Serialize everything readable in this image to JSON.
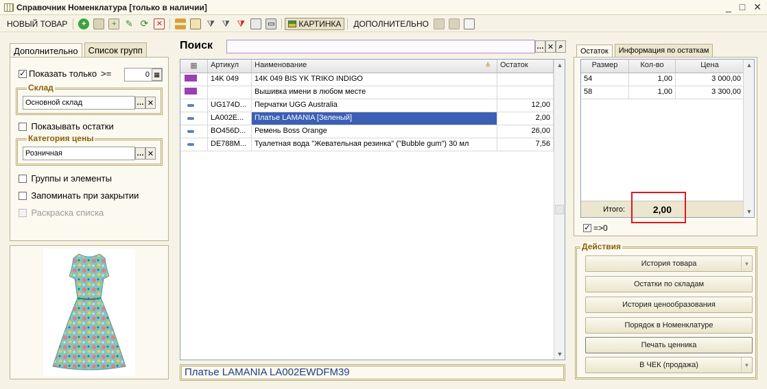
{
  "window": {
    "title": "Справочник Номенклатура [только в наличии]",
    "controls": [
      "_",
      "□",
      "✕"
    ]
  },
  "toolbar": {
    "new_item": "НОВЫЙ ТОВАР",
    "picture": "КАРТИНКА",
    "additional": "ДОПОЛНИТЕЛЬНО"
  },
  "left": {
    "tabs": [
      "Дополнительно",
      "Список групп"
    ],
    "show_only_label": "Показать только",
    "ge": ">=",
    "show_only_value": "0",
    "warehouse_title": "Склад",
    "warehouse_value": "Основной склад",
    "show_remains": "Показывать остатки",
    "price_category_title": "Категория цены",
    "price_category_value": "Розничная",
    "groups_and_elements": "Группы и элементы",
    "remember_on_close": "Запоминать при закрытии",
    "list_coloring": "Раскраска списка"
  },
  "search": {
    "label": "Поиск",
    "value": ""
  },
  "grid": {
    "columns": [
      "Артикул",
      "Наименование",
      "Остаток"
    ],
    "rows": [
      {
        "icon": "group",
        "article": "14K 049",
        "name": "14K 049 BIS YK TRIKO INDIGO",
        "stock": ""
      },
      {
        "icon": "group",
        "article": "",
        "name": "Вышивка имени в любом месте",
        "stock": ""
      },
      {
        "icon": "item",
        "article": "UG174D...",
        "name": "Перчатки UGG Australia",
        "stock": "12,00"
      },
      {
        "icon": "item",
        "article": "LA002E...",
        "name": "Платье LAMANIA [Зеленый]",
        "stock": "2,00"
      },
      {
        "icon": "item",
        "article": "BO456D...",
        "name": "Ремень Boss Orange",
        "stock": "26,00"
      },
      {
        "icon": "item",
        "article": "DE788M...",
        "name": "Туалетная вода \"Жевательная резинка\" (\"Bubble gum\") 30 мл",
        "stock": "7,56"
      }
    ],
    "selected_index": 3
  },
  "status": {
    "text": "Платье LAMANIA LA002EWDFM39"
  },
  "right": {
    "tabs": [
      "Остаток",
      "Информация по остаткам"
    ],
    "columns": [
      "Размер",
      "Кол-во",
      "Цена"
    ],
    "rows": [
      {
        "size": "54",
        "qty": "1,00",
        "price": "3 000,00"
      },
      {
        "size": "58",
        "qty": "1,00",
        "price": "3 300,00"
      }
    ],
    "total_label": "Итого:",
    "total_value": "2,00",
    "filter_label": "=>0",
    "actions_title": "Действия",
    "actions": [
      "История товара",
      "Остатки по складам",
      "История ценообразования",
      "Порядок в Номенклатуре",
      "Печать ценника",
      "В ЧЕК (продажа)"
    ]
  },
  "colors": {
    "selection": "#3a5fb5",
    "group_icon": "#9b3fb5",
    "highlight_box": "#e0161d",
    "title_accent": "#8a5f00"
  }
}
